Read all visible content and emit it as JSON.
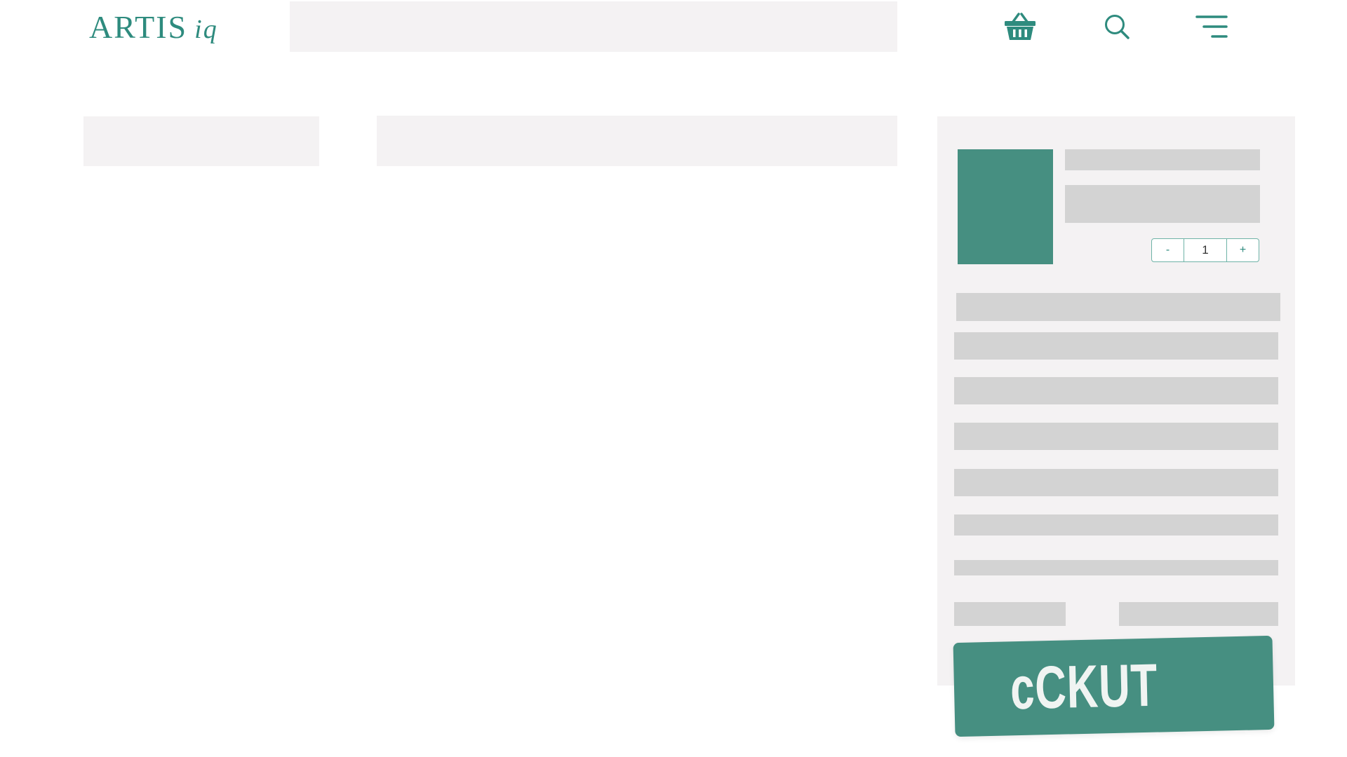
{
  "header": {
    "logo": {
      "main": "ARTIS",
      "suffix": "iq"
    },
    "icons": [
      "basket-icon",
      "search-icon",
      "menu-icon"
    ]
  },
  "cart": {
    "quantity": {
      "decrement_label": "-",
      "value": "1",
      "increment_label": "+"
    },
    "checkout_label": "cCKUT"
  },
  "colors": {
    "accent": "#2e8b7e",
    "checkout_bg": "#468f81",
    "placeholder_light": "#f4f2f3",
    "placeholder_gray": "#d3d3d3"
  }
}
